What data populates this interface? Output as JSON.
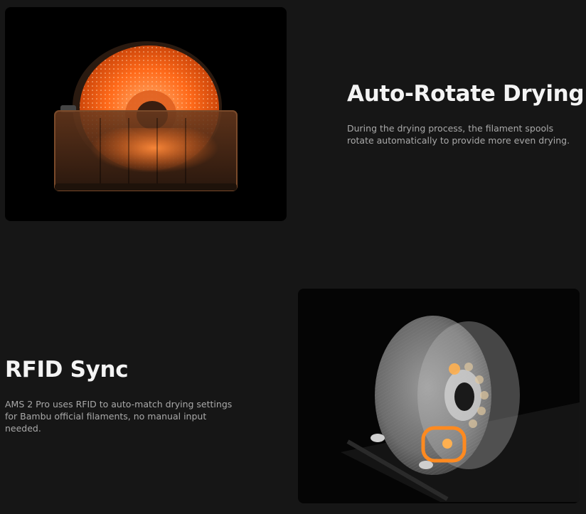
{
  "features": [
    {
      "title": "Auto-Rotate Drying",
      "description": "During the drying process, the filament spools rotate automatically to provide more even drying."
    },
    {
      "title": "RFID Sync",
      "description": "AMS 2 Pro uses RFID to auto-match drying settings for Bambu official filaments, no manual input needed."
    }
  ],
  "colors": {
    "page_background": "#161616",
    "card_background": "#000000",
    "accent_orange": "#ff6a1a",
    "title_text": "#f4f4f4",
    "body_text": "#a9a9a9"
  }
}
